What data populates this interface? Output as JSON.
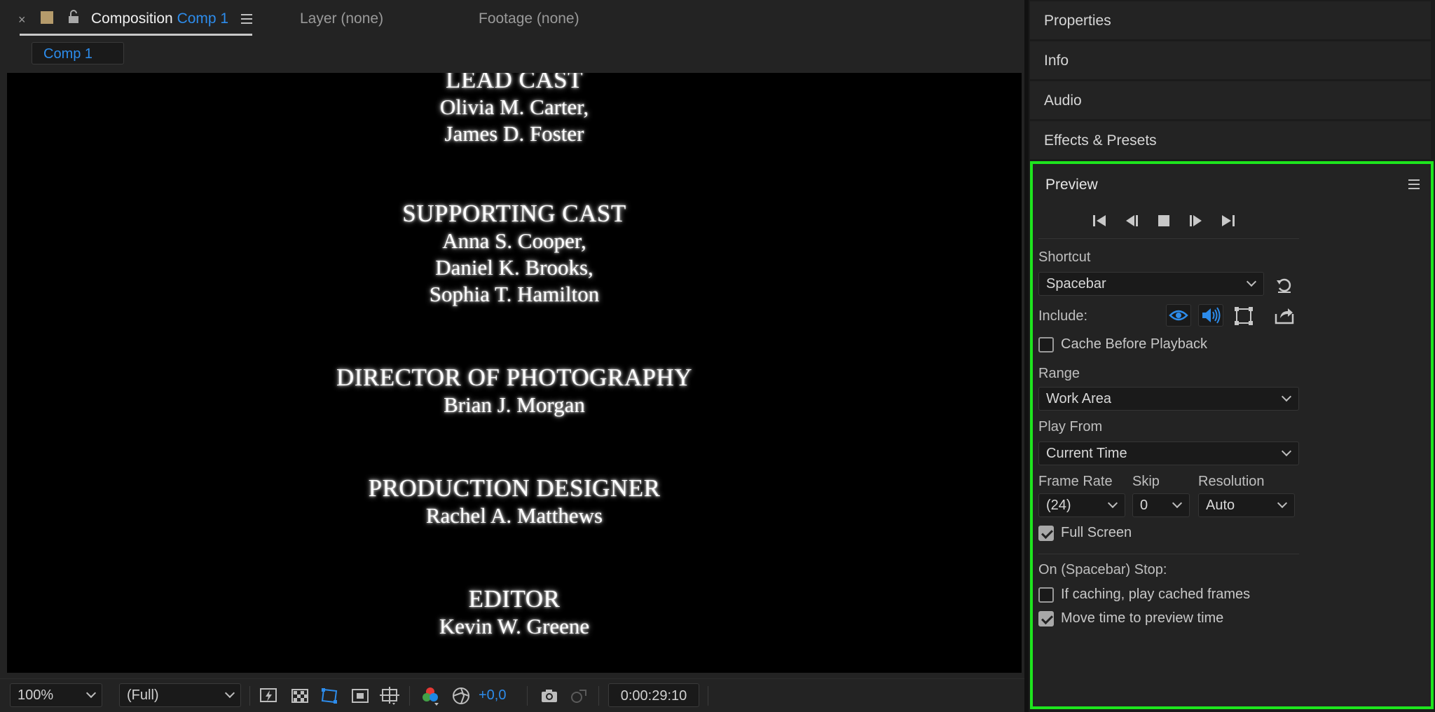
{
  "composition_panel": {
    "tab_title_prefix": "Composition",
    "tab_comp_name": "Comp 1",
    "layer_tab": "Layer (none)",
    "footage_tab": "Footage (none)",
    "subtab": "Comp 1",
    "credits": [
      {
        "heading": "LEAD CAST",
        "names": [
          "Olivia M. Carter,",
          "James D. Foster"
        ]
      },
      {
        "heading": "SUPPORTING CAST",
        "names": [
          "Anna S. Cooper,",
          "Daniel K. Brooks,",
          "Sophia T. Hamilton"
        ]
      },
      {
        "heading": "DIRECTOR OF PHOTOGRAPHY",
        "names": [
          "Brian J. Morgan"
        ]
      },
      {
        "heading": "PRODUCTION DESIGNER",
        "names": [
          "Rachel A. Matthews"
        ]
      },
      {
        "heading": "EDITOR",
        "names": [
          "Kevin W. Greene"
        ]
      }
    ],
    "footer": {
      "zoom": "100%",
      "resolution": "(Full)",
      "exposure": "+0,0",
      "timecode": "0:00:29:10"
    }
  },
  "right_panels": {
    "properties": "Properties",
    "info": "Info",
    "audio": "Audio",
    "effects": "Effects & Presets"
  },
  "preview": {
    "title": "Preview",
    "shortcut_label": "Shortcut",
    "shortcut_value": "Spacebar",
    "include_label": "Include:",
    "cache_before_playback": "Cache Before Playback",
    "cache_before_playback_checked": false,
    "range_label": "Range",
    "range_value": "Work Area",
    "play_from_label": "Play From",
    "play_from_value": "Current Time",
    "frame_rate_label": "Frame Rate",
    "frame_rate_value": "(24)",
    "skip_label": "Skip",
    "skip_value": "0",
    "resolution_label": "Resolution",
    "resolution_value": "Auto",
    "full_screen": "Full Screen",
    "full_screen_checked": true,
    "stop_label": "On (Spacebar) Stop:",
    "if_caching": "If caching, play cached frames",
    "if_caching_checked": false,
    "move_time": "Move time to preview time",
    "move_time_checked": true
  },
  "colors": {
    "accent_blue": "#2d8ceb",
    "highlight_green": "#1ee51e"
  },
  "icons": [
    "close-icon",
    "lock-icon",
    "panel-menu-icon",
    "first-frame-icon",
    "previous-frame-icon",
    "stop-icon",
    "next-frame-icon",
    "last-frame-icon",
    "reset-icon",
    "eye-icon",
    "speaker-icon",
    "overlay-icon",
    "export-icon",
    "camera-icon"
  ]
}
